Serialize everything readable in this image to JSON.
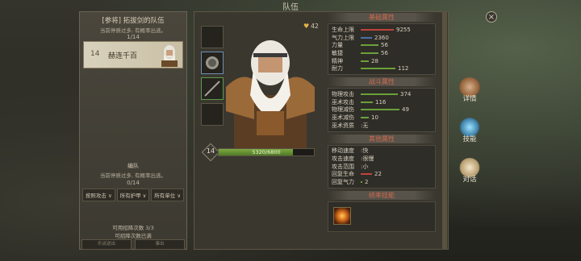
{
  "window": {
    "title": "队伍"
  },
  "left_panel": {
    "title": "[参将] 拓拔剑的队伍",
    "subtitle": "当前停质过多, 有概率出逃。",
    "count": "1/14",
    "hero": {
      "level": "14",
      "name": "赫连千百"
    },
    "section2_title": "编队",
    "section2_subtitle": "当前停质过多, 有概率出逃。",
    "section2_count": "0/14",
    "filters": [
      "按照攻击 ∨",
      "所有护甲 ∨",
      "所有单位 ∨"
    ],
    "recruit_line1": "可用招降次数 3/3",
    "recruit_line2": "可招降次数已满",
    "btn_left": "乐谈送出",
    "btn_right": "事出"
  },
  "unit": {
    "favor": "42",
    "level": "14",
    "hp_text": "5320/6800",
    "hp_fraction": 0.78
  },
  "stats": {
    "basic_title": "基础属性",
    "basic": [
      {
        "label": "生命上限",
        "value": "9255",
        "color": "#c0443a",
        "fill": 0.85
      },
      {
        "label": "气力上限",
        "value": "2360",
        "color": "#4b6fa8",
        "fill": 0.3
      },
      {
        "label": "力量",
        "value": "56",
        "color": "#6aa13a",
        "fill": 0.45
      },
      {
        "label": "敏捷",
        "value": "56",
        "color": "#6aa13a",
        "fill": 0.45
      },
      {
        "label": "精神",
        "value": "28",
        "color": "#6aa13a",
        "fill": 0.2
      },
      {
        "label": "耐力",
        "value": "112",
        "color": "#6aa13a",
        "fill": 0.9
      }
    ],
    "combat_title": "战斗属性",
    "combat": [
      {
        "label": "物理攻击",
        "value": "374",
        "color": "#6aa13a",
        "fill": 0.95
      },
      {
        "label": "巫术攻击",
        "value": "116",
        "color": "#6aa13a",
        "fill": 0.32
      },
      {
        "label": "物理减伤",
        "value": "49",
        "color": "#6aa13a",
        "fill": 1.0
      },
      {
        "label": "巫术减伤",
        "value": "10",
        "color": "#6aa13a",
        "fill": 0.2
      },
      {
        "label": "巫术资质",
        "value": ":无",
        "color": "",
        "fill": 0
      }
    ],
    "other_title": "其他属性",
    "other": [
      {
        "label": "移动速度",
        "value": ":快",
        "color": "",
        "fill": 0
      },
      {
        "label": "攻击速度",
        "value": ":很慢",
        "color": "",
        "fill": 0
      },
      {
        "label": "攻击范围",
        "value": ":小",
        "color": "",
        "fill": 0
      },
      {
        "label": "回复生命",
        "value": "22",
        "color": "#c0443a",
        "fill": 0.3
      },
      {
        "label": "回复气力",
        "value": "2",
        "color": "#6aa13a",
        "fill": 0.05
      }
    ],
    "skill_title": "统率技能"
  },
  "side_nav": [
    {
      "label": "详情",
      "icon": "fist-icon"
    },
    {
      "label": "技能",
      "icon": "crystal-book-icon"
    },
    {
      "label": "对话",
      "icon": "speech-bubble-icon"
    }
  ],
  "close_icon": "×"
}
